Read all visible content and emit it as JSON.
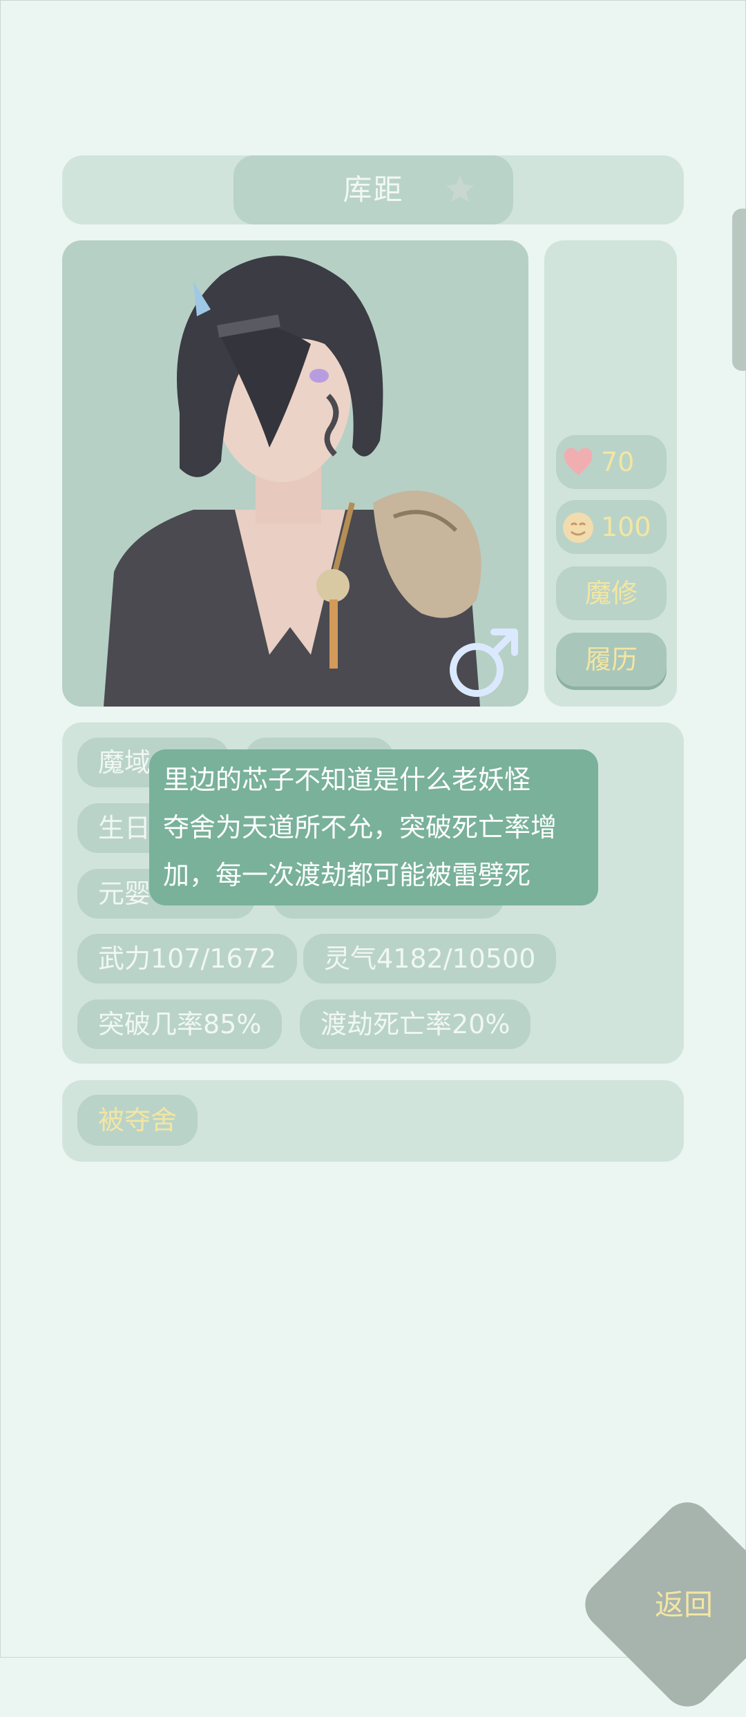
{
  "header": {
    "name": "库距",
    "favorite_icon": "star-icon"
  },
  "portrait": {
    "gender_icon": "male-symbol-icon",
    "gender_color": "#dbe9ff"
  },
  "side": {
    "health_icon": "heart-icon",
    "health_value": "70",
    "mood_icon": "smile-face-icon",
    "mood_value": "100",
    "sect_label": "魔修",
    "resume_label": "履历"
  },
  "info": {
    "row1_a": "魔域",
    "row2_a": "生日",
    "row3_a": "元婴",
    "martial": "武力107/1672",
    "spirit": "灵气4182/10500",
    "breakthrough": "突破几率85%",
    "tribulation": "渡劫死亡率20%"
  },
  "traits": {
    "trait1": "被夺舍"
  },
  "tooltip": {
    "line1": "里边的芯子不知道是什么老妖怪",
    "line2": "夺舍为天道所不允，突破死亡率增",
    "line3": "加，每一次渡劫都可能被雷劈死"
  },
  "back": {
    "label": "返回"
  },
  "colors": {
    "background": "#ebf5f1",
    "panel": "#d1e4dc",
    "pill": "#b9d3c8",
    "accent_text": "#f3e6a2",
    "tooltip": "#79b19a"
  }
}
